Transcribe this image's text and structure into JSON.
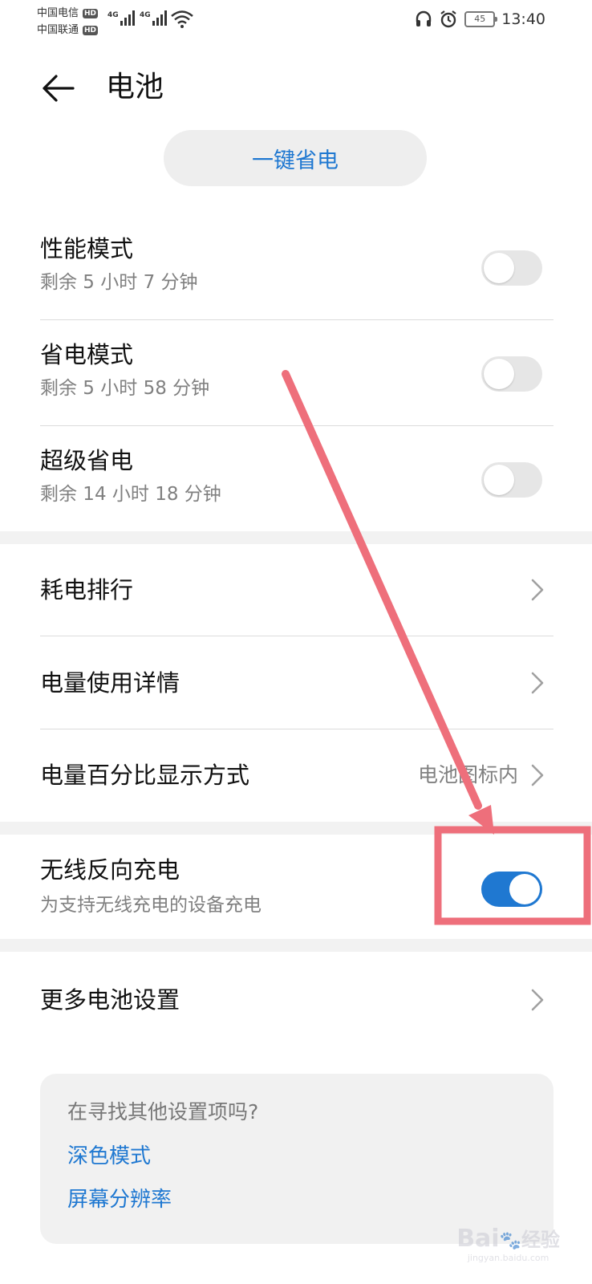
{
  "status_bar": {
    "carrier1": "中国电信",
    "carrier2": "中国联通",
    "hd": "HD",
    "network1": "4G",
    "network2": "4G",
    "battery_level": "45",
    "time": "13:40",
    "icons": [
      "headset-icon",
      "alarm-icon",
      "battery-icon",
      "wifi-icon",
      "signal-icon"
    ]
  },
  "header": {
    "title": "电池"
  },
  "one_click_save": "一键省电",
  "modes": [
    {
      "title": "性能模式",
      "subtitle": "剩余 5 小时 7 分钟",
      "enabled": false
    },
    {
      "title": "省电模式",
      "subtitle": "剩余 5 小时 58 分钟",
      "enabled": false
    },
    {
      "title": "超级省电",
      "subtitle": "剩余 14 小时 18 分钟",
      "enabled": false
    }
  ],
  "links": [
    {
      "title": "耗电排行"
    },
    {
      "title": "电量使用详情"
    },
    {
      "title": "电量百分比显示方式",
      "value": "电池图标内"
    }
  ],
  "wireless": {
    "title": "无线反向充电",
    "subtitle": "为支持无线充电的设备充电",
    "enabled": true
  },
  "more": {
    "title": "更多电池设置"
  },
  "suggestions": {
    "question": "在寻找其他设置项吗?",
    "items": [
      "深色模式",
      "屏幕分辨率"
    ]
  },
  "watermark": {
    "brand": "Bai",
    "brand2": "经验",
    "url": "jingyan.baidu.com"
  },
  "colors": {
    "accent": "#1f78d1",
    "annotation": "#ee6f7b",
    "toggle_off": "#e6e6e6"
  }
}
